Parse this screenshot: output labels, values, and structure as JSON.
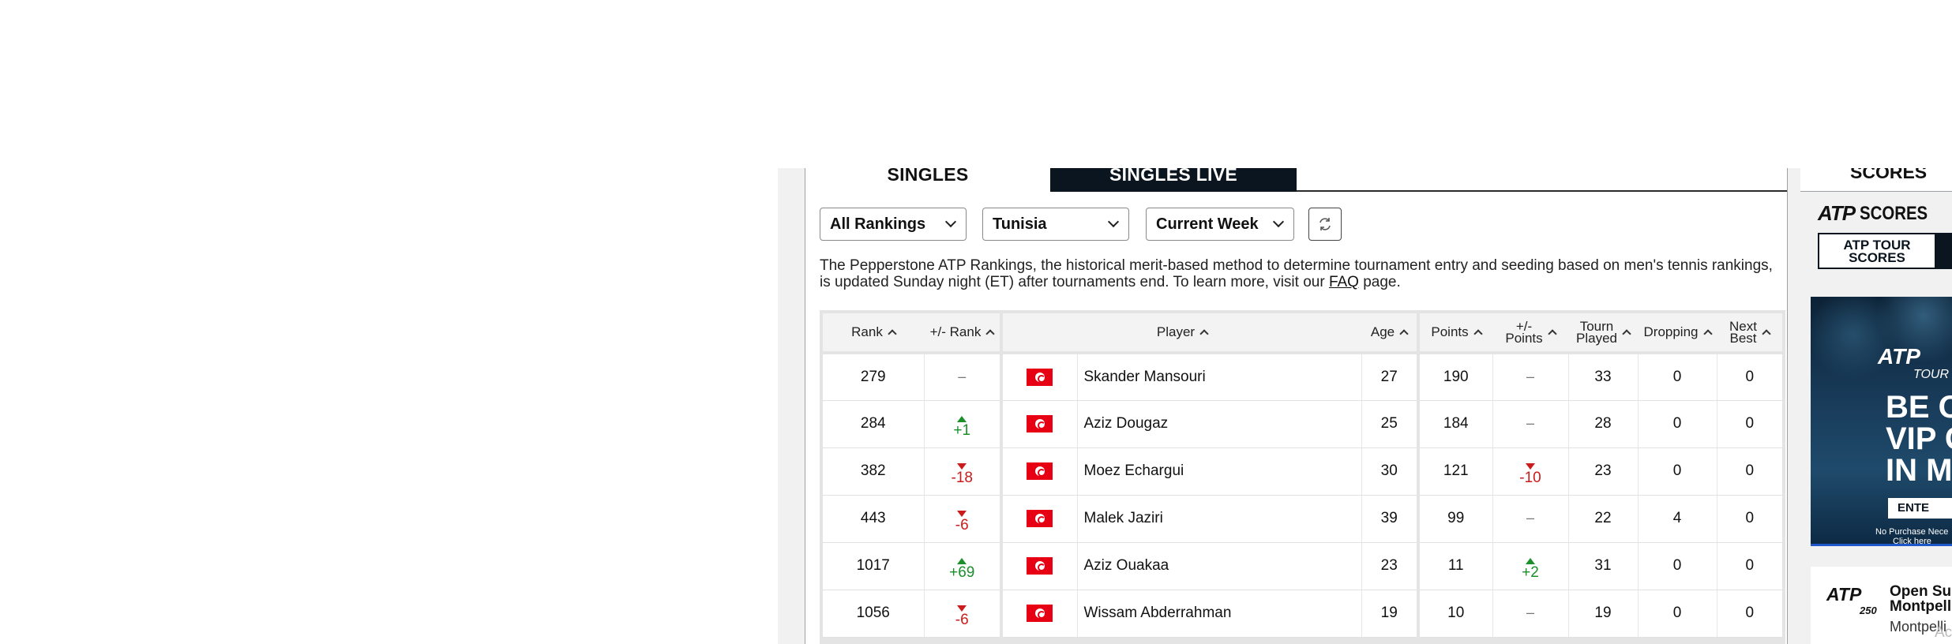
{
  "tabs": {
    "singles": "SINGLES",
    "singles_live": "SINGLES LIVE"
  },
  "filters": {
    "rankings": "All Rankings",
    "country": "Tunisia",
    "week": "Current Week"
  },
  "description": {
    "text": "The Pepperstone ATP Rankings, the historical merit-based method to determine tournament entry and seeding based on men's tennis rankings, is updated Sunday night (ET) after tournaments end. To learn more, visit our ",
    "faq": "FAQ",
    "suffix": " page."
  },
  "table": {
    "headers": {
      "rank": "Rank",
      "rank_change": "+/- Rank",
      "player": "Player",
      "age": "Age",
      "points": "Points",
      "points_change_1": "+/-",
      "points_change_2": "Points",
      "tourn_1": "Tourn",
      "tourn_2": "Played",
      "dropping": "Dropping",
      "next_1": "Next",
      "next_2": "Best"
    },
    "rows": [
      {
        "rank": "279",
        "rank_change": "–",
        "rank_dir": "none",
        "country": "Tunisia",
        "player": "Skander Mansouri",
        "age": "27",
        "points": "190",
        "points_change": "–",
        "points_dir": "none",
        "tourn": "33",
        "dropping": "0",
        "next_best": "0"
      },
      {
        "rank": "284",
        "rank_change": "+1",
        "rank_dir": "up",
        "country": "Tunisia",
        "player": "Aziz Dougaz",
        "age": "25",
        "points": "184",
        "points_change": "–",
        "points_dir": "none",
        "tourn": "28",
        "dropping": "0",
        "next_best": "0"
      },
      {
        "rank": "382",
        "rank_change": "-18",
        "rank_dir": "down",
        "country": "Tunisia",
        "player": "Moez Echargui",
        "age": "30",
        "points": "121",
        "points_change": "-10",
        "points_dir": "down",
        "tourn": "23",
        "dropping": "0",
        "next_best": "0"
      },
      {
        "rank": "443",
        "rank_change": "-6",
        "rank_dir": "down",
        "country": "Tunisia",
        "player": "Malek Jaziri",
        "age": "39",
        "points": "99",
        "points_change": "–",
        "points_dir": "none",
        "tourn": "22",
        "dropping": "4",
        "next_best": "0"
      },
      {
        "rank": "1017",
        "rank_change": "+69",
        "rank_dir": "up",
        "country": "Tunisia",
        "player": "Aziz Ouakaa",
        "age": "23",
        "points": "11",
        "points_change": "+2",
        "points_dir": "up",
        "tourn": "31",
        "dropping": "0",
        "next_best": "0"
      },
      {
        "rank": "1056",
        "rank_change": "-6",
        "rank_dir": "down",
        "country": "Tunisia",
        "player": "Wissam Abderrahman",
        "age": "19",
        "points": "10",
        "points_change": "–",
        "points_dir": "none",
        "tourn": "19",
        "dropping": "0",
        "next_best": "0"
      }
    ]
  },
  "sidebar": {
    "top_label": "SCORES",
    "logo_atp": "ATP",
    "logo_scores": "SCORES",
    "tour_button": "ATP TOUR SCORES",
    "ad": {
      "logo": "ATP",
      "sub": "TOUR",
      "line1": "BE O",
      "line2": "VIP G",
      "line3": "IN M",
      "button": "ENTE",
      "fine1": "No Purchase Nece",
      "fine2": "Click here"
    },
    "tournament": {
      "logo": "ATP",
      "level": "250",
      "name1": "Open Su",
      "name2": "Montpell",
      "location": "Montpelli"
    },
    "ad_choice": "Ac"
  },
  "colors": {
    "up": "#1a8f2a",
    "down": "#cc1b1b",
    "tab_dark": "#0b1520",
    "flag_red": "#e70013"
  },
  "icons": {
    "refresh": "refresh-icon",
    "sort": "sort-up-icon",
    "chevron": "chevron-down-icon",
    "flag": "tunisia-flag-icon"
  }
}
